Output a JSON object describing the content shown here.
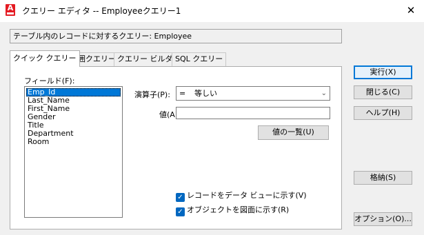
{
  "window": {
    "title": "クエリー エディタ -- Employeeクエリー1",
    "close_glyph": "✕"
  },
  "header": {
    "info_text": "テーブル内のレコードに対するクエリー:  Employee"
  },
  "tabs": [
    {
      "label": "クイック クエリー",
      "active": true
    },
    {
      "label": "範囲クエリー",
      "active": false
    },
    {
      "label": "クエリー ビルダー",
      "active": false
    },
    {
      "label": "SQL クエリー",
      "active": false
    }
  ],
  "quick_query": {
    "field_label": "フィールド(F):",
    "fields": [
      "Emp_Id",
      "Last_Name",
      "First_Name",
      "Gender",
      "Title",
      "Department",
      "Room"
    ],
    "selected_field": "Emp_Id",
    "operator_label": "演算子(P):",
    "operator_symbol": "=",
    "operator_value": "等しい",
    "value_label": "値(A):",
    "value": "",
    "list_values_button": "値の一覧(U)",
    "checkbox_show_data": {
      "label": "レコードをデータ ビューに示す(V)",
      "checked": true
    },
    "checkbox_show_objects": {
      "label": "オブジェクトを図面に示す(R)",
      "checked": true
    }
  },
  "buttons": {
    "execute": "実行(X)",
    "close": "閉じる(C)",
    "help": "ヘルプ(H)",
    "store": "格納(S)",
    "options": "オプション(O)..."
  },
  "colors": {
    "accent": "#0078d7",
    "app_icon": "#e41b23",
    "checkbox": "#0067c0"
  }
}
